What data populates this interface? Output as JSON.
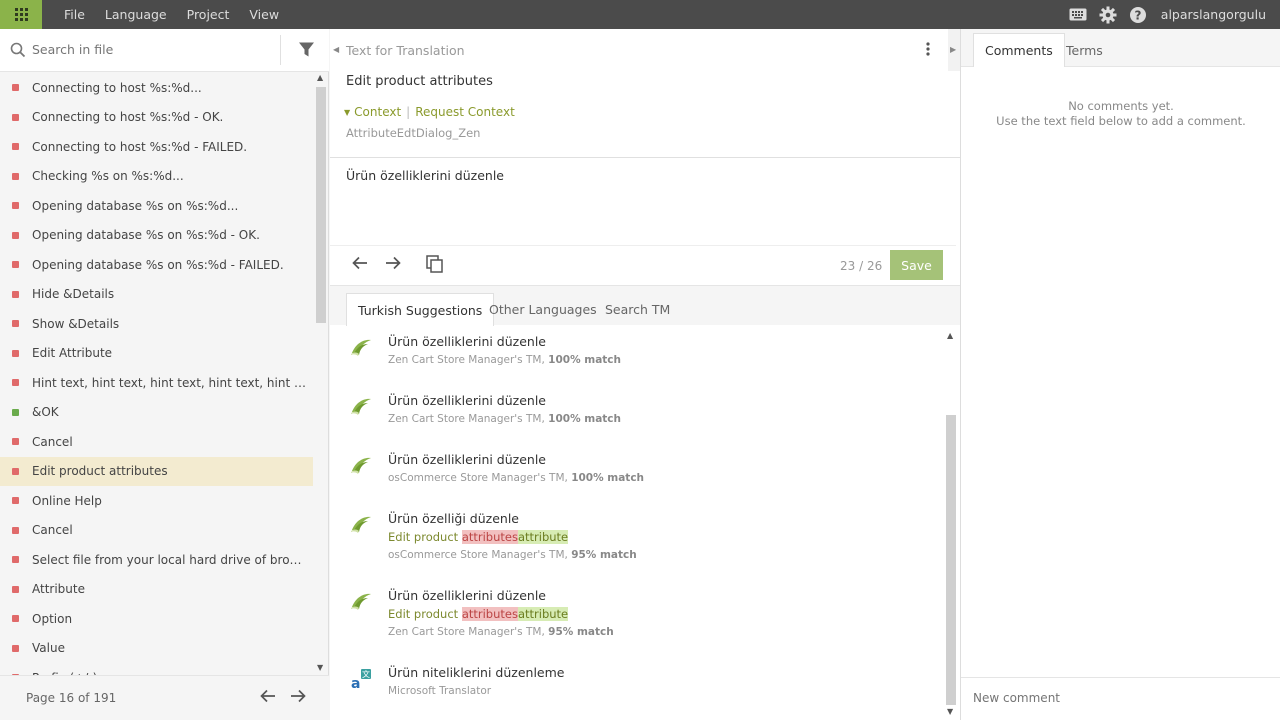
{
  "menu": {
    "items": [
      "File",
      "Language",
      "Project",
      "View"
    ]
  },
  "user": {
    "name": "alparslangorgulu"
  },
  "icons": {
    "apps": "grid-icon",
    "keyboard": "keyboard-icon",
    "settings": "gear-icon",
    "help": "help-icon",
    "search": "search-icon",
    "filter": "filter-icon"
  },
  "colors": {
    "accent": "#8bb34a",
    "topbar": "#4b4b4b",
    "untranslated": "#e06a6a",
    "translated": "#6aab4c",
    "active_row": "#f3ebd0",
    "save": "#a5c278"
  },
  "left": {
    "search_placeholder": "Search in file",
    "strings": [
      {
        "text": "Connecting to host %s:%d...",
        "status": "untranslated"
      },
      {
        "text": "Connecting to host %s:%d - OK.",
        "status": "untranslated"
      },
      {
        "text": "Connecting to host %s:%d - FAILED.",
        "status": "untranslated"
      },
      {
        "text": "Checking %s on %s:%d...",
        "status": "untranslated"
      },
      {
        "text": "Opening database %s on %s:%d...",
        "status": "untranslated"
      },
      {
        "text": "Opening database %s on %s:%d - OK.",
        "status": "untranslated"
      },
      {
        "text": "Opening database %s on %s:%d - FAILED.",
        "status": "untranslated"
      },
      {
        "text": "Hide &Details",
        "status": "untranslated"
      },
      {
        "text": "Show &Details",
        "status": "untranslated"
      },
      {
        "text": "Edit Attribute",
        "status": "untranslated"
      },
      {
        "text": "Hint text, hint text, hint text, hint text, hint text, hint...",
        "status": "untranslated"
      },
      {
        "text": "&OK",
        "status": "translated"
      },
      {
        "text": "Cancel",
        "status": "untranslated"
      },
      {
        "text": "Edit product attributes",
        "status": "untranslated",
        "active": true
      },
      {
        "text": "Online Help",
        "status": "untranslated"
      },
      {
        "text": "Cancel",
        "status": "untranslated"
      },
      {
        "text": "Select file from your local hard drive of browse FTP ...",
        "status": "untranslated"
      },
      {
        "text": "Attribute",
        "status": "untranslated"
      },
      {
        "text": "Option",
        "status": "untranslated"
      },
      {
        "text": "Value",
        "status": "untranslated"
      },
      {
        "text": "Prefix (+/-)",
        "status": "untranslated"
      }
    ],
    "page_text": "Page 16 of 191"
  },
  "center": {
    "source_label": "Text for Translation",
    "source_text": "Edit product attributes",
    "context_label": "Context",
    "request_context_label": "Request Context",
    "context_key": "AttributeEdtDialog_Zen",
    "translation_value": "Ürün özelliklerini düzenle",
    "counter": "23 / 26",
    "save_label": "Save",
    "tabs": [
      "Turkish Suggestions",
      "Other Languages",
      "Search TM"
    ],
    "suggestions": [
      {
        "text": "Ürün özelliklerini düzenle",
        "diff_prefix": "",
        "diff_del": "",
        "diff_ins": "",
        "source": "Zen Cart Store Manager's TM,",
        "match": "100% match",
        "kind": "tm"
      },
      {
        "text": "Ürün özelliklerini düzenle",
        "diff_prefix": "",
        "diff_del": "",
        "diff_ins": "",
        "source": "Zen Cart Store Manager's TM,",
        "match": "100% match",
        "kind": "tm"
      },
      {
        "text": "Ürün özelliklerini düzenle",
        "diff_prefix": "",
        "diff_del": "",
        "diff_ins": "",
        "source": "osCommerce Store Manager's TM,",
        "match": "100% match",
        "kind": "tm"
      },
      {
        "text": "Ürün özelliği düzenle",
        "diff_prefix": "Edit product ",
        "diff_del": "attributes",
        "diff_ins": "attribute",
        "source": "osCommerce Store Manager's TM,",
        "match": "95% match",
        "kind": "tm"
      },
      {
        "text": "Ürün özelliklerini düzenle",
        "diff_prefix": "Edit product ",
        "diff_del": "attributes",
        "diff_ins": "attribute",
        "source": "Zen Cart Store Manager's TM,",
        "match": "95% match",
        "kind": "tm"
      },
      {
        "text": "Ürün niteliklerini düzenleme",
        "diff_prefix": "",
        "diff_del": "",
        "diff_ins": "",
        "source": "Microsoft Translator",
        "match": "",
        "kind": "mt"
      }
    ]
  },
  "right": {
    "tabs": [
      "Comments",
      "Terms"
    ],
    "no_comments_line1": "No comments yet.",
    "no_comments_line2": "Use the text field below to add a comment.",
    "new_comment_placeholder": "New comment"
  }
}
